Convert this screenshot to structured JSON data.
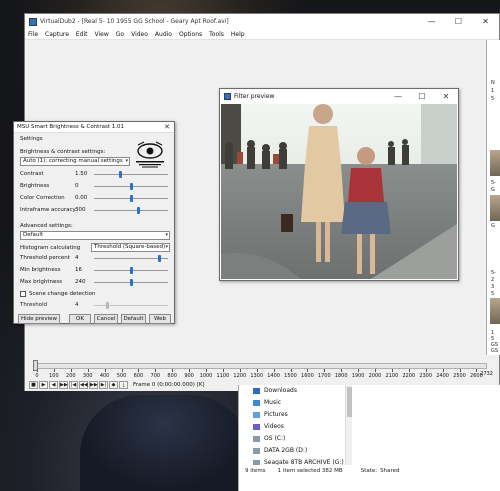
{
  "main_window": {
    "title": "VirtualDub2 - [Real 5- 10 1955 GG School - Geary Apt Roof.avi]",
    "menu": [
      "File",
      "Capture",
      "Edit",
      "View",
      "Go",
      "Video",
      "Audio",
      "Options",
      "Tools",
      "Help"
    ],
    "controls": {
      "minimize": "—",
      "maximize": "☐",
      "close": "✕"
    }
  },
  "timeline": {
    "ticks": [
      "0",
      "100",
      "200",
      "300",
      "400",
      "500",
      "600",
      "700",
      "800",
      "900",
      "1000",
      "1100",
      "1200",
      "1300",
      "1400",
      "1500",
      "1600",
      "1700",
      "1800",
      "1900",
      "2000",
      "2100",
      "2200",
      "2300",
      "2400",
      "2500",
      "2600"
    ],
    "end_label": "2732",
    "frame_readout": "Frame 0 (0:00:00.000) [K]",
    "transport_buttons": [
      "■",
      "▶",
      "◀",
      "▶▶",
      "|◀",
      "◀◀",
      "▶▶",
      "▶|",
      "◆",
      "⤓"
    ]
  },
  "filter_preview": {
    "title": "Filter preview",
    "controls": {
      "minimize": "—",
      "maximize": "☐",
      "close": "✕"
    }
  },
  "msu_dialog": {
    "title": "MSU Smart Brightness & Contrast 1.01",
    "close": "✕",
    "settings_label": "Settings",
    "bc_settings_label": "Brightness & contrast settings:",
    "mode_value": "Auto (1): correcting manual settings",
    "params": [
      {
        "label": "Contrast",
        "value": "1.50",
        "level": 0.35
      },
      {
        "label": "Brightness",
        "value": "0",
        "level": 0.5
      },
      {
        "label": "Color Correction",
        "value": "0.00",
        "level": 0.5
      },
      {
        "label": "Intraframe accuracy",
        "value": "300",
        "level": 0.6
      }
    ],
    "advanced_label": "Advanced settings:",
    "advanced_value": "Default",
    "histogram_label": "Histogram calculating",
    "histogram_value": "Threshold (Square-based)",
    "adv_params": [
      {
        "label": "Threshold percent",
        "value": "4",
        "level": 0.9
      },
      {
        "label": "Min brightness",
        "value": "16",
        "level": 0.5
      },
      {
        "label": "Max brightness",
        "value": "240",
        "level": 0.5
      }
    ],
    "scene_change_label": "Scene change detection",
    "threshold_label": "Threshold",
    "threshold_value": "4",
    "buttons": {
      "hide_preview": "Hide preview",
      "ok": "OK",
      "cancel": "Cancel",
      "default": "Default",
      "web": "Web"
    }
  },
  "explorer": {
    "items": [
      {
        "label": "Downloads",
        "icon": "download-icon"
      },
      {
        "label": "Music",
        "icon": "music-icon"
      },
      {
        "label": "Pictures",
        "icon": "pictures-icon"
      },
      {
        "label": "Videos",
        "icon": "videos-icon"
      },
      {
        "label": "OS (C:)",
        "icon": "drive-icon"
      },
      {
        "label": "DATA 2GB (D:)",
        "icon": "drive-icon"
      },
      {
        "label": "Seagate 8TB ARCHIVE (G:)",
        "icon": "drive-icon"
      }
    ],
    "status": {
      "count": "9 items",
      "selected": "1 item selected  382 MB",
      "state": "State:",
      "shared": "Shared"
    }
  },
  "right_sliver": {
    "labels": [
      "N",
      "1",
      "5",
      "5-",
      "G",
      "G",
      "5-",
      "2",
      "3",
      "5",
      "1",
      "5",
      "GS",
      "GS",
      "5-",
      "1",
      "5"
    ]
  }
}
